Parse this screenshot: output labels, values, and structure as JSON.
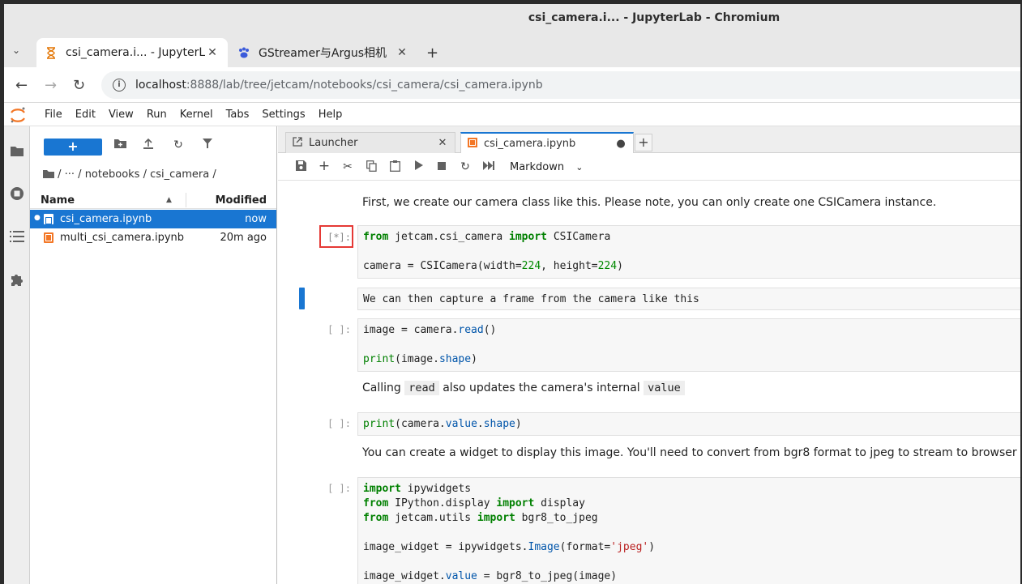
{
  "window": {
    "title": "csi_camera.i... - JupyterLab - Chromium"
  },
  "browser": {
    "tabs": [
      {
        "label": "csi_camera.i... - JupyterL",
        "active": true,
        "favicon": "hourglass-icon"
      },
      {
        "label": "GStreamer与Argus相机",
        "active": false,
        "favicon": "baidu-paw-icon"
      }
    ],
    "url_host": "localhost",
    "url_path": ":8888/lab/tree/jetcam/notebooks/csi_camera/csi_camera.ipynb"
  },
  "menubar": {
    "items": [
      "File",
      "Edit",
      "View",
      "Run",
      "Kernel",
      "Tabs",
      "Settings",
      "Help"
    ]
  },
  "filebrowser": {
    "new_label": "+",
    "breadcrumb": "/  ···  / notebooks / csi_camera /",
    "col_name": "Name",
    "col_modified": "Modified",
    "files": [
      {
        "name": "csi_camera.ipynb",
        "modified": "now",
        "selected": true
      },
      {
        "name": "multi_csi_camera.ipynb",
        "modified": "20m ago",
        "selected": false
      }
    ]
  },
  "dock": {
    "tabs": [
      {
        "label": "Launcher",
        "close": "✕"
      },
      {
        "label": "csi_camera.ipynb",
        "close": "●"
      }
    ],
    "celltype": "Markdown"
  },
  "cells": {
    "md1": "First, we create our camera class like this. Please note, you can only create one CSICamera instance.",
    "p1": "[*]:",
    "md2": "We can then capture a frame from the camera like this",
    "p2": "[ ]:",
    "md3_a": "Calling",
    "md3_code1": "read",
    "md3_b": "also updates the camera's internal",
    "md3_code2": "value",
    "p3": "[ ]:",
    "md4": "You can create a widget to display this image. You'll need to convert from bgr8 format to jpeg to stream to browser",
    "p4": "[ ]:"
  },
  "colors": {
    "accent": "#1976d2",
    "running_border": "#e53935"
  }
}
